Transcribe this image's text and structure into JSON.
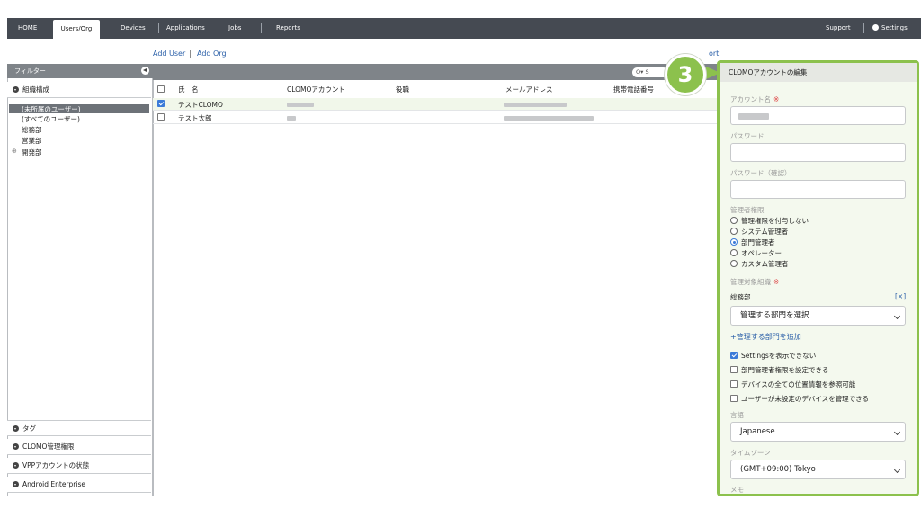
{
  "nav": {
    "home": "HOME",
    "users_org": "Users/Org",
    "devices": "Devices",
    "applications": "Applications",
    "jobs": "Jobs",
    "reports": "Reports",
    "support": "Support",
    "settings": "Settings"
  },
  "actions": {
    "add_user": "Add User",
    "separator": "|",
    "add_org": "Add Org",
    "import_partial": "ort"
  },
  "filter": {
    "title": "フィルター",
    "org_section": "組織構成",
    "orgs": [
      "(未所属のユーザー)",
      "(すべてのユーザー)",
      "総務部",
      "営業部",
      "開発部"
    ],
    "bottom_sections": [
      "タグ",
      "CLOMO管理権限",
      "VPPアカウントの状態",
      "Android Enterprise"
    ]
  },
  "table": {
    "search_placeholder": "Q▾ S",
    "columns": [
      "氏　名",
      "CLOMOアカウント",
      "役職",
      "メールアドレス",
      "携帯電話番号"
    ],
    "rows": [
      {
        "name": "テストCLOMO",
        "checked": true
      },
      {
        "name": "テスト太郎",
        "checked": false
      }
    ]
  },
  "step": {
    "number": "3"
  },
  "edit": {
    "title": "CLOMOアカウントの編集",
    "account_name_label": "アカウント名",
    "required_mark": "※",
    "password_label": "パスワード",
    "password_confirm_label": "パスワード（確認）",
    "admin_role_label": "管理者権限",
    "roles": [
      "管理権限を付与しない",
      "システム管理者",
      "部門管理者",
      "オペレーター",
      "カスタム管理者"
    ],
    "selected_role": "部門管理者",
    "managed_org_label": "管理対象組織",
    "managed_org_value": "総務部",
    "remove_mark": "[×]",
    "dept_select": "管理する部門を選択",
    "add_dept_link": "+管理する部門を追加",
    "options": [
      {
        "label": "Settingsを表示できない",
        "checked": true
      },
      {
        "label": "部門管理者権限を設定できる",
        "checked": false
      },
      {
        "label": "デバイスの全ての位置情報を参照可能",
        "checked": false
      },
      {
        "label": "ユーザーが未設定のデバイスを管理できる",
        "checked": false
      }
    ],
    "language_label": "言語",
    "language_value": "Japanese",
    "timezone_label": "タイムゾーン",
    "timezone_value": "(GMT+09:00) Tokyo",
    "memo_label": "メモ"
  },
  "colors": {
    "accent": "#8cc14d",
    "nav_bg": "#454a52",
    "link": "#2a5fa8",
    "check": "#3b7bd8"
  }
}
